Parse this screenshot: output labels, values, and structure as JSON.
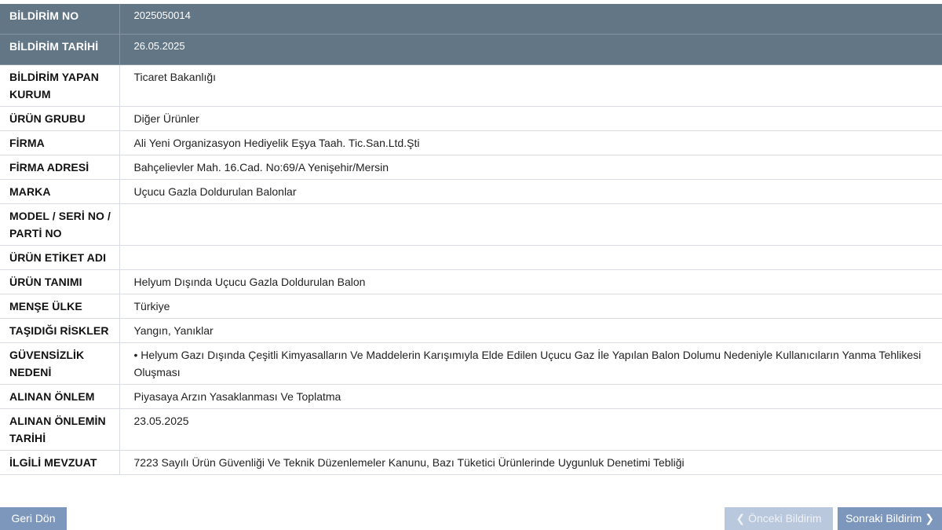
{
  "header": {
    "no_label": "BİLDİRİM NO",
    "no_value": "2025050014",
    "date_label": "BİLDİRİM TARİHİ",
    "date_value": "26.05.2025"
  },
  "rows": [
    {
      "label": "BİLDİRİM YAPAN KURUM",
      "value": "Ticaret Bakanlığı"
    },
    {
      "label": "ÜRÜN GRUBU",
      "value": "Diğer Ürünler"
    },
    {
      "label": "FİRMA",
      "value": "Ali Yeni Organizasyon Hediyelik Eşya Taah. Tic.San.Ltd.Şti"
    },
    {
      "label": "FİRMA ADRESİ",
      "value": "Bahçelievler Mah. 16.Cad. No:69/A Yenişehir/Mersin"
    },
    {
      "label": "MARKA",
      "value": "Uçucu Gazla Doldurulan Balonlar"
    },
    {
      "label": "MODEL / SERİ NO / PARTİ NO",
      "value": ""
    },
    {
      "label": "ÜRÜN ETİKET ADI",
      "value": ""
    },
    {
      "label": "ÜRÜN TANIMI",
      "value": "Helyum Dışında Uçucu Gazla Doldurulan Balon"
    },
    {
      "label": "MENŞE ÜLKE",
      "value": "Türkiye"
    },
    {
      "label": "TAŞIDIĞI RİSKLER",
      "value": "Yangın, Yanıklar"
    },
    {
      "label": "GÜVENSİZLİK NEDENİ",
      "value": "• Helyum Gazı Dışında Çeşitli Kimyasalların Ve Maddelerin Karışımıyla Elde Edilen Uçucu Gaz İle Yapılan Balon Dolumu Nedeniyle Kullanıcıların Yanma Tehlikesi Oluşması"
    },
    {
      "label": "ALINAN ÖNLEM",
      "value": "Piyasaya Arzın Yasaklanması Ve Toplatma"
    },
    {
      "label": "ALINAN ÖNLEMİN TARİHİ",
      "value": "23.05.2025"
    },
    {
      "label": "İLGİLİ MEVZUAT",
      "value": "7223 Sayılı Ürün Güvenliği Ve Teknik Düzenlemeler Kanunu, Bazı Tüketici Ürünlerinde Uygunluk Denetimi Tebliği"
    }
  ],
  "buttons": {
    "back": "Geri Dön",
    "prev": "Önceki Bildirim",
    "next": "Sonraki Bildirim"
  },
  "colors": {
    "header_bg": "#627686",
    "button_bg": "#7d97bc",
    "button_disabled_bg": "#b9c8dc"
  }
}
